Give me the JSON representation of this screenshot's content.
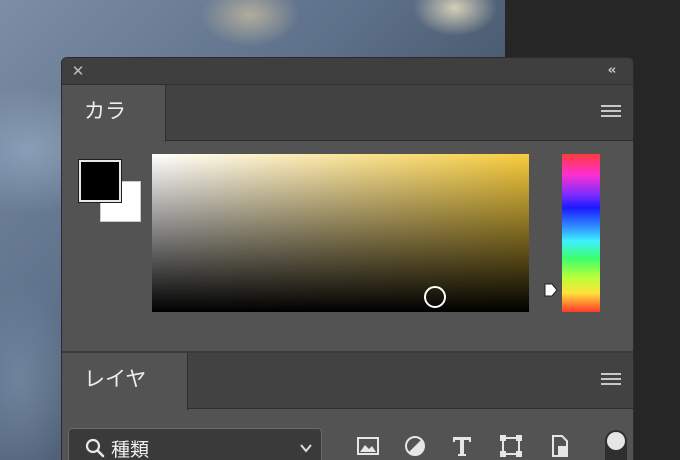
{
  "panel": {
    "close_glyph": "✕",
    "collapse_glyph": "‹‹"
  },
  "color_panel": {
    "tab_label": "カラー",
    "menu_icon": "hamburger-menu-icon",
    "foreground_color": "#000000",
    "background_color": "#ffffff",
    "field_hue_color": "#f7cc3c"
  },
  "layers_panel": {
    "tab_label": "レイヤー",
    "menu_icon": "hamburger-menu-icon",
    "filter_kind": {
      "label": "種類",
      "icon": "search-icon"
    },
    "filter_icons": [
      "image-filter-icon",
      "adjustment-filter-icon",
      "type-filter-icon",
      "shape-filter-icon",
      "smart-object-filter-icon"
    ]
  }
}
